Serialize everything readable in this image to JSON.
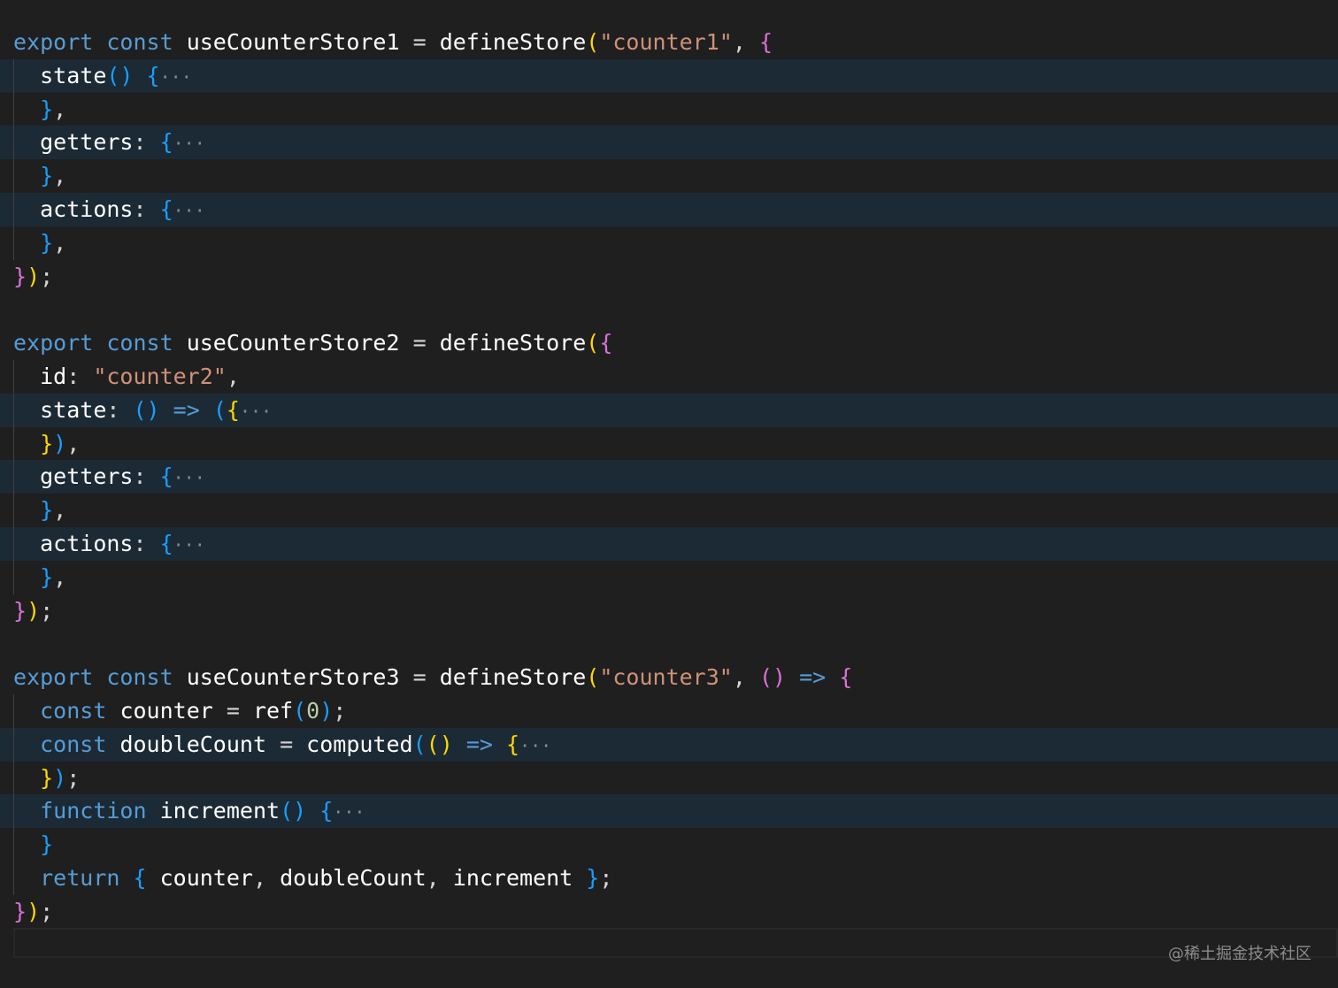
{
  "colors": {
    "background": "#1f1f1f",
    "folded_line": "#1c2a36",
    "keyword": "#569cd6",
    "identifier": "#ffffff",
    "string": "#ce9178",
    "number": "#b5cea8",
    "bracket_1": "#da70d6",
    "bracket_2": "#179fff",
    "bracket_3": "#ffd700"
  },
  "code": {
    "lines": [
      {
        "folded": false,
        "tokens": [
          {
            "c": "kw",
            "t": "export"
          },
          {
            "c": "",
            "t": " "
          },
          {
            "c": "kw",
            "t": "const"
          },
          {
            "c": "",
            "t": " "
          },
          {
            "c": "ident",
            "t": "useCounterStore1"
          },
          {
            "c": "",
            "t": " = "
          },
          {
            "c": "ident",
            "t": "defineStore"
          },
          {
            "c": "p3",
            "t": "("
          },
          {
            "c": "str",
            "t": "\"counter1\""
          },
          {
            "c": "",
            "t": ", "
          },
          {
            "c": "p1",
            "t": "{"
          }
        ]
      },
      {
        "folded": true,
        "tokens": [
          {
            "c": "",
            "t": "  "
          },
          {
            "c": "ident",
            "t": "state"
          },
          {
            "c": "p2",
            "t": "()"
          },
          {
            "c": "",
            "t": " "
          },
          {
            "c": "p2",
            "t": "{"
          },
          {
            "c": "ell",
            "t": "···"
          }
        ]
      },
      {
        "folded": false,
        "tokens": [
          {
            "c": "",
            "t": "  "
          },
          {
            "c": "p2",
            "t": "}"
          },
          {
            "c": "",
            "t": ","
          }
        ]
      },
      {
        "folded": true,
        "tokens": [
          {
            "c": "",
            "t": "  "
          },
          {
            "c": "ident",
            "t": "getters"
          },
          {
            "c": "",
            "t": ": "
          },
          {
            "c": "p2",
            "t": "{"
          },
          {
            "c": "ell",
            "t": "···"
          }
        ]
      },
      {
        "folded": false,
        "tokens": [
          {
            "c": "",
            "t": "  "
          },
          {
            "c": "p2",
            "t": "}"
          },
          {
            "c": "",
            "t": ","
          }
        ]
      },
      {
        "folded": true,
        "tokens": [
          {
            "c": "",
            "t": "  "
          },
          {
            "c": "ident",
            "t": "actions"
          },
          {
            "c": "",
            "t": ": "
          },
          {
            "c": "p2",
            "t": "{"
          },
          {
            "c": "ell",
            "t": "···"
          }
        ]
      },
      {
        "folded": false,
        "tokens": [
          {
            "c": "",
            "t": "  "
          },
          {
            "c": "p2",
            "t": "}"
          },
          {
            "c": "",
            "t": ","
          }
        ]
      },
      {
        "folded": false,
        "tokens": [
          {
            "c": "p1",
            "t": "}"
          },
          {
            "c": "p3",
            "t": ")"
          },
          {
            "c": "",
            "t": ";"
          }
        ]
      },
      {
        "folded": false,
        "tokens": []
      },
      {
        "folded": false,
        "tokens": [
          {
            "c": "kw",
            "t": "export"
          },
          {
            "c": "",
            "t": " "
          },
          {
            "c": "kw",
            "t": "const"
          },
          {
            "c": "",
            "t": " "
          },
          {
            "c": "ident",
            "t": "useCounterStore2"
          },
          {
            "c": "",
            "t": " = "
          },
          {
            "c": "ident",
            "t": "defineStore"
          },
          {
            "c": "p3",
            "t": "("
          },
          {
            "c": "p1",
            "t": "{"
          }
        ]
      },
      {
        "folded": false,
        "tokens": [
          {
            "c": "",
            "t": "  "
          },
          {
            "c": "ident",
            "t": "id"
          },
          {
            "c": "",
            "t": ": "
          },
          {
            "c": "str",
            "t": "\"counter2\""
          },
          {
            "c": "",
            "t": ","
          }
        ]
      },
      {
        "folded": true,
        "tokens": [
          {
            "c": "",
            "t": "  "
          },
          {
            "c": "ident",
            "t": "state"
          },
          {
            "c": "",
            "t": ": "
          },
          {
            "c": "p2",
            "t": "()"
          },
          {
            "c": "",
            "t": " "
          },
          {
            "c": "kw",
            "t": "=>"
          },
          {
            "c": "",
            "t": " "
          },
          {
            "c": "p2",
            "t": "("
          },
          {
            "c": "p3",
            "t": "{"
          },
          {
            "c": "ell",
            "t": "···"
          }
        ]
      },
      {
        "folded": false,
        "tokens": [
          {
            "c": "",
            "t": "  "
          },
          {
            "c": "p3",
            "t": "}"
          },
          {
            "c": "p2",
            "t": ")"
          },
          {
            "c": "",
            "t": ","
          }
        ]
      },
      {
        "folded": true,
        "tokens": [
          {
            "c": "",
            "t": "  "
          },
          {
            "c": "ident",
            "t": "getters"
          },
          {
            "c": "",
            "t": ": "
          },
          {
            "c": "p2",
            "t": "{"
          },
          {
            "c": "ell",
            "t": "···"
          }
        ]
      },
      {
        "folded": false,
        "tokens": [
          {
            "c": "",
            "t": "  "
          },
          {
            "c": "p2",
            "t": "}"
          },
          {
            "c": "",
            "t": ","
          }
        ]
      },
      {
        "folded": true,
        "tokens": [
          {
            "c": "",
            "t": "  "
          },
          {
            "c": "ident",
            "t": "actions"
          },
          {
            "c": "",
            "t": ": "
          },
          {
            "c": "p2",
            "t": "{"
          },
          {
            "c": "ell",
            "t": "···"
          }
        ]
      },
      {
        "folded": false,
        "tokens": [
          {
            "c": "",
            "t": "  "
          },
          {
            "c": "p2",
            "t": "}"
          },
          {
            "c": "",
            "t": ","
          }
        ]
      },
      {
        "folded": false,
        "tokens": [
          {
            "c": "p1",
            "t": "}"
          },
          {
            "c": "p3",
            "t": ")"
          },
          {
            "c": "",
            "t": ";"
          }
        ]
      },
      {
        "folded": false,
        "tokens": []
      },
      {
        "folded": false,
        "tokens": [
          {
            "c": "kw",
            "t": "export"
          },
          {
            "c": "",
            "t": " "
          },
          {
            "c": "kw",
            "t": "const"
          },
          {
            "c": "",
            "t": " "
          },
          {
            "c": "ident",
            "t": "useCounterStore3"
          },
          {
            "c": "",
            "t": " = "
          },
          {
            "c": "ident",
            "t": "defineStore"
          },
          {
            "c": "p3",
            "t": "("
          },
          {
            "c": "str",
            "t": "\"counter3\""
          },
          {
            "c": "",
            "t": ", "
          },
          {
            "c": "p1",
            "t": "()"
          },
          {
            "c": "",
            "t": " "
          },
          {
            "c": "kw",
            "t": "=>"
          },
          {
            "c": "",
            "t": " "
          },
          {
            "c": "p1",
            "t": "{"
          }
        ]
      },
      {
        "folded": false,
        "tokens": [
          {
            "c": "",
            "t": "  "
          },
          {
            "c": "kw",
            "t": "const"
          },
          {
            "c": "",
            "t": " "
          },
          {
            "c": "ident",
            "t": "counter"
          },
          {
            "c": "",
            "t": " = "
          },
          {
            "c": "ident",
            "t": "ref"
          },
          {
            "c": "p2",
            "t": "("
          },
          {
            "c": "num",
            "t": "0"
          },
          {
            "c": "p2",
            "t": ")"
          },
          {
            "c": "",
            "t": ";"
          }
        ]
      },
      {
        "folded": true,
        "tokens": [
          {
            "c": "",
            "t": "  "
          },
          {
            "c": "kw",
            "t": "const"
          },
          {
            "c": "",
            "t": " "
          },
          {
            "c": "ident",
            "t": "doubleCount"
          },
          {
            "c": "",
            "t": " = "
          },
          {
            "c": "ident",
            "t": "computed"
          },
          {
            "c": "p2",
            "t": "("
          },
          {
            "c": "p3",
            "t": "()"
          },
          {
            "c": "",
            "t": " "
          },
          {
            "c": "kw",
            "t": "=>"
          },
          {
            "c": "",
            "t": " "
          },
          {
            "c": "p3",
            "t": "{"
          },
          {
            "c": "ell",
            "t": "···"
          }
        ]
      },
      {
        "folded": false,
        "tokens": [
          {
            "c": "",
            "t": "  "
          },
          {
            "c": "p3",
            "t": "}"
          },
          {
            "c": "p2",
            "t": ")"
          },
          {
            "c": "",
            "t": ";"
          }
        ]
      },
      {
        "folded": true,
        "tokens": [
          {
            "c": "",
            "t": "  "
          },
          {
            "c": "kw",
            "t": "function"
          },
          {
            "c": "",
            "t": " "
          },
          {
            "c": "ident",
            "t": "increment"
          },
          {
            "c": "p2",
            "t": "()"
          },
          {
            "c": "",
            "t": " "
          },
          {
            "c": "p2",
            "t": "{"
          },
          {
            "c": "ell",
            "t": "···"
          }
        ]
      },
      {
        "folded": false,
        "tokens": [
          {
            "c": "",
            "t": "  "
          },
          {
            "c": "p2",
            "t": "}"
          }
        ]
      },
      {
        "folded": false,
        "tokens": [
          {
            "c": "",
            "t": "  "
          },
          {
            "c": "ctrl",
            "t": "return"
          },
          {
            "c": "",
            "t": " "
          },
          {
            "c": "p2",
            "t": "{"
          },
          {
            "c": "",
            "t": " "
          },
          {
            "c": "ident",
            "t": "counter"
          },
          {
            "c": "",
            "t": ", "
          },
          {
            "c": "ident",
            "t": "doubleCount"
          },
          {
            "c": "",
            "t": ", "
          },
          {
            "c": "ident",
            "t": "increment"
          },
          {
            "c": "",
            "t": " "
          },
          {
            "c": "p2",
            "t": "}"
          },
          {
            "c": "",
            "t": ";"
          }
        ]
      },
      {
        "folded": false,
        "tokens": [
          {
            "c": "p1",
            "t": "}"
          },
          {
            "c": "p3",
            "t": ")"
          },
          {
            "c": "",
            "t": ";"
          }
        ]
      }
    ]
  },
  "watermark": "@稀土掘金技术社区"
}
